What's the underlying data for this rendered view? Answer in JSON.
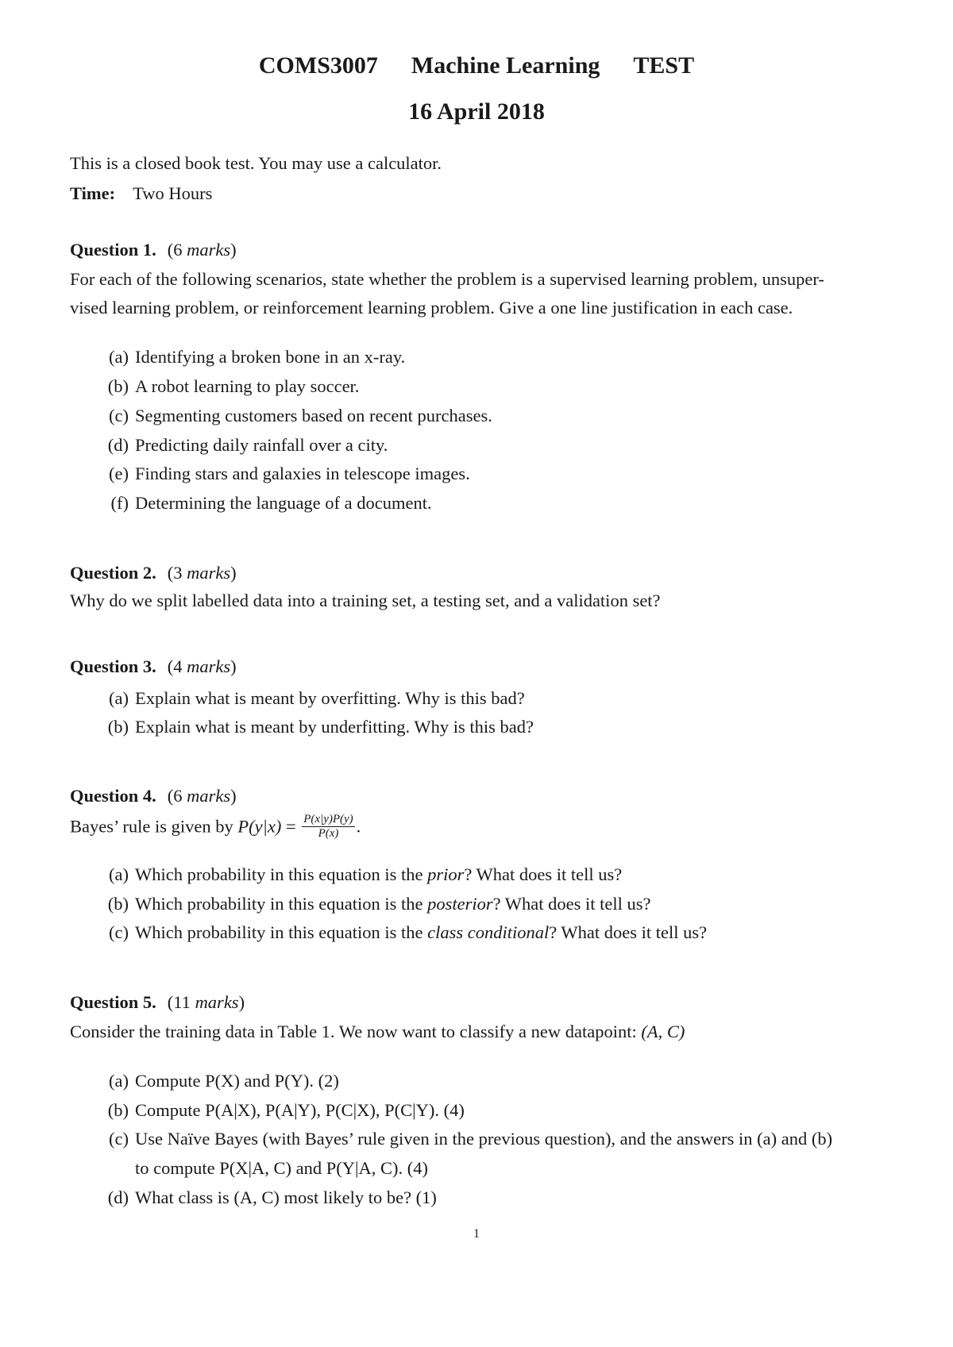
{
  "header": {
    "course_code": "COMS3007",
    "course_name": "Machine Learning",
    "assessment": "TEST",
    "date": "16 April 2018"
  },
  "intro": {
    "instructions": "This is a closed book test. You may use a calculator.",
    "time_label": "Time:",
    "time_value": "Two Hours"
  },
  "questions": [
    {
      "heading": "Question 1.",
      "marks_num": "(6 ",
      "marks_word": "marks",
      "marks_close": ")",
      "body": [
        "For each of the following scenarios, state whether the problem is a supervised learning problem, unsuper-",
        "vised learning problem, or reinforcement learning problem. Give a one line justification in each case."
      ],
      "items": [
        {
          "label": "(a)",
          "text": "Identifying a broken bone in an x-ray."
        },
        {
          "label": "(b)",
          "text": "A robot learning to play soccer."
        },
        {
          "label": "(c)",
          "text": "Segmenting customers based on recent purchases."
        },
        {
          "label": "(d)",
          "text": "Predicting daily rainfall over a city."
        },
        {
          "label": "(e)",
          "text": "Finding stars and galaxies in telescope images."
        },
        {
          "label": "(f)",
          "text": "Determining the language of a document."
        }
      ]
    },
    {
      "heading": "Question 2.",
      "marks_num": "(3 ",
      "marks_word": "marks",
      "marks_close": ")",
      "body": [
        "Why do we split labelled data into a training set, a testing set, and a validation set?"
      ]
    },
    {
      "heading": "Question 3.",
      "marks_num": "(4 ",
      "marks_word": "marks",
      "marks_close": ")",
      "items": [
        {
          "label": "(a)",
          "text": "Explain what is meant by overfitting. Why is this bad?"
        },
        {
          "label": "(b)",
          "text": "Explain what is meant by underfitting. Why is this bad?"
        }
      ]
    },
    {
      "heading": "Question 4.",
      "marks_num": "(6 ",
      "marks_word": "marks",
      "marks_close": ")",
      "bayes_prefix": "Bayes’ rule is given by ",
      "bayes_lhs": "P(y|x)",
      "bayes_eq": " = ",
      "bayes_num": "P(x|y)P(y)",
      "bayes_den": "P(x)",
      "bayes_end": ".",
      "items": [
        {
          "label": "(a)",
          "pre": "Which probability in this equation is the ",
          "term": "prior",
          "post": "? What does it tell us?"
        },
        {
          "label": "(b)",
          "pre": "Which probability in this equation is the ",
          "term": "posterior",
          "post": "? What does it tell us?"
        },
        {
          "label": "(c)",
          "pre": "Which probability in this equation is the ",
          "term": "class conditional",
          "post": "? What does it tell us?"
        }
      ]
    },
    {
      "heading": "Question 5.",
      "marks_num": "(11 ",
      "marks_word": "marks",
      "marks_close": ")",
      "body_pre": "Consider the training data in Table 1. We now want to classify a new datapoint: ",
      "body_math": "(A, C)",
      "items": [
        {
          "label": "(a)",
          "text": "Compute P(X) and P(Y). (2)"
        },
        {
          "label": "(b)",
          "text": "Compute P(A|X), P(A|Y), P(C|X), P(C|Y). (4)"
        },
        {
          "label": "(c)",
          "text": "Use Naïve Bayes (with Bayes’ rule given in the previous question), and the answers in (a) and (b)",
          "text_cont": "to compute P(X|A, C) and P(Y|A, C). (4)"
        },
        {
          "label": "(d)",
          "text": "What class is (A, C) most likely to be? (1)"
        }
      ]
    }
  ],
  "footer": {
    "page_number": "1"
  }
}
